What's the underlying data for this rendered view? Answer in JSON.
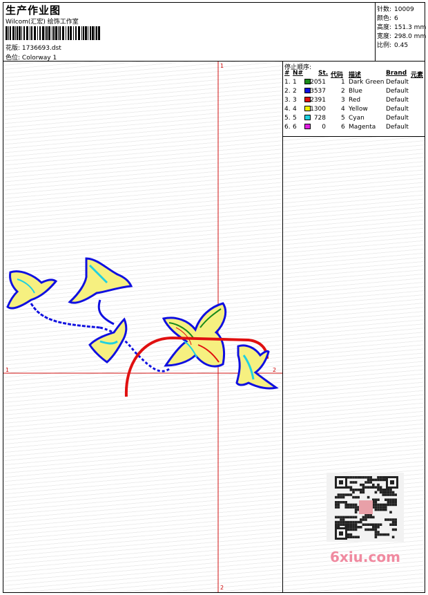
{
  "header": {
    "title": "生产作业图",
    "company": "Wilcom(汇宏) 绘饰工作室",
    "filename_label": "花版:",
    "filename": "1736693.dst",
    "colorway_label": "色位:",
    "colorway": "Colorway 1"
  },
  "stats": [
    {
      "label": "针数:",
      "value": "10009"
    },
    {
      "label": "颜色:",
      "value": "6"
    },
    {
      "label": "高度:",
      "value": "151.3 mm"
    },
    {
      "label": "宽度:",
      "value": "298.0 mm"
    },
    {
      "label": "比例:",
      "value": "0.45"
    }
  ],
  "sequence": {
    "title": "停止顺序:",
    "headers": {
      "num": "#",
      "n": "N#",
      "st": "St.",
      "code": "代码",
      "desc": "描述",
      "brand": "Brand",
      "elem": "元素"
    },
    "rows": [
      {
        "num": "1.",
        "n": "1",
        "color": "#1a8a1a",
        "st": "2051",
        "code": "1",
        "desc": "Dark Green",
        "brand": "Default"
      },
      {
        "num": "2.",
        "n": "2",
        "color": "#1010e0",
        "st": "3537",
        "code": "2",
        "desc": "Blue",
        "brand": "Default"
      },
      {
        "num": "3.",
        "n": "3",
        "color": "#e01010",
        "st": "2391",
        "code": "3",
        "desc": "Red",
        "brand": "Default"
      },
      {
        "num": "4.",
        "n": "4",
        "color": "#f0f000",
        "st": "1300",
        "code": "4",
        "desc": "Yellow",
        "brand": "Default"
      },
      {
        "num": "5.",
        "n": "5",
        "color": "#20d0e0",
        "st": "728",
        "code": "5",
        "desc": "Cyan",
        "brand": "Default"
      },
      {
        "num": "6.",
        "n": "6",
        "color": "#e020e0",
        "st": "0",
        "code": "6",
        "desc": "Magenta",
        "brand": "Default"
      }
    ]
  },
  "axes": {
    "top": "1",
    "bottom": "2",
    "left": "1",
    "right": "2"
  },
  "watermark": "6xiu.com"
}
